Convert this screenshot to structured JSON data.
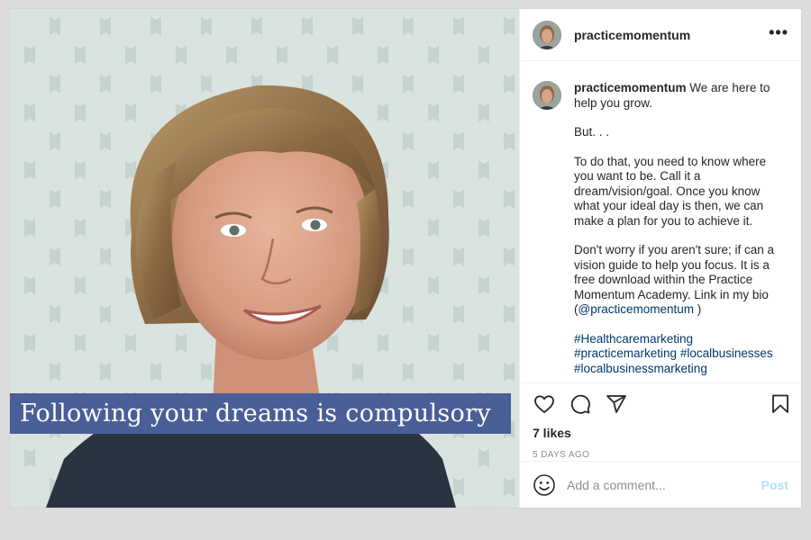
{
  "post": {
    "username": "practicemomentum",
    "more_label": "•••",
    "image": {
      "overlay_text": "Following your dreams is compulsory",
      "banner_color": "#4a5f97"
    },
    "caption": {
      "username": "practicemomentum",
      "first_line": " We are here to help you grow.",
      "para_but": "But. . .",
      "para_dream": "To do that, you need to know where you want to be. Call it a dream/vision/goal. Once you know what your ideal day is then, we can make a plan for you to achieve it.",
      "para_guide": "Don't worry if you aren't sure; if can a vision guide to help you focus. It is a free download within the Practice Momentum Academy. Link in my bio (",
      "mention": "@practicemomentum",
      "para_guide_end": " )",
      "hashtags": [
        "#Healthcaremarketing",
        "#practicemarketing",
        "#localbusinesses",
        "#localbusinessmarketing"
      ]
    },
    "icons": {
      "like": "heart-icon",
      "comment": "comment-bubble-icon",
      "share": "paper-plane-icon",
      "save": "bookmark-icon",
      "emoji": "smiley-icon"
    },
    "likes": "7 likes",
    "timestamp": "5 DAYS AGO",
    "comment_box": {
      "placeholder": "Add a comment...",
      "post_label": "Post"
    },
    "colors": {
      "link": "#00376b",
      "post_button_disabled": "#b2dffc",
      "muted": "#8e8e8e"
    }
  }
}
